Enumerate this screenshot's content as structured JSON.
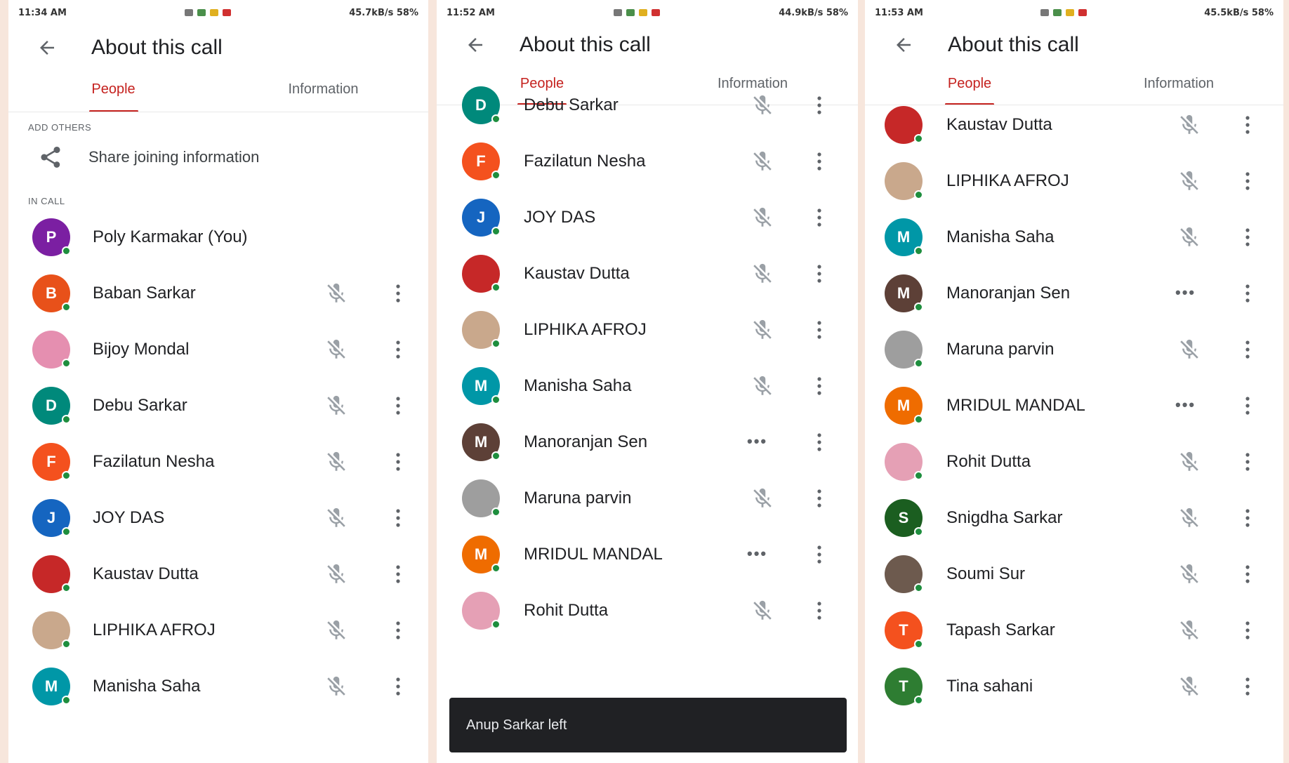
{
  "panels": [
    {
      "status_time": "11:34 AM",
      "status_right": "45.7kB/s 58%",
      "title": "About this call",
      "tabs": [
        "People",
        "Information"
      ],
      "add_others_label": "ADD OTHERS",
      "share_label": "Share joining information",
      "in_call_label": "IN CALL",
      "participants": [
        {
          "name": "Poly Karmakar (You)",
          "initial": "P",
          "color": "#7b1fa2",
          "status": "none"
        },
        {
          "name": "Baban Sarkar",
          "initial": "B",
          "color": "#e8511a",
          "status": "muted"
        },
        {
          "name": "Bijoy Mondal",
          "initial": "",
          "color": "#e58fb0",
          "status": "muted"
        },
        {
          "name": "Debu Sarkar",
          "initial": "D",
          "color": "#00897b",
          "status": "muted"
        },
        {
          "name": "Fazilatun Nesha",
          "initial": "F",
          "color": "#f4511e",
          "status": "muted"
        },
        {
          "name": "JOY DAS",
          "initial": "J",
          "color": "#1565c0",
          "status": "muted"
        },
        {
          "name": "Kaustav Dutta",
          "initial": "",
          "color": "#c62828",
          "status": "muted"
        },
        {
          "name": "LIPHIKA AFROJ",
          "initial": "",
          "color": "#c9a88c",
          "status": "muted"
        },
        {
          "name": "Manisha Saha",
          "initial": "M",
          "color": "#0097a7",
          "status": "muted"
        }
      ]
    },
    {
      "status_time": "11:52 AM",
      "status_right": "44.9kB/s 58%",
      "title": "About this call",
      "tabs": [
        "People",
        "Information"
      ],
      "participants": [
        {
          "name": "Debu Sarkar",
          "initial": "D",
          "color": "#00897b",
          "status": "muted"
        },
        {
          "name": "Fazilatun Nesha",
          "initial": "F",
          "color": "#f4511e",
          "status": "muted"
        },
        {
          "name": "JOY DAS",
          "initial": "J",
          "color": "#1565c0",
          "status": "muted"
        },
        {
          "name": "Kaustav Dutta",
          "initial": "",
          "color": "#c62828",
          "status": "muted"
        },
        {
          "name": "LIPHIKA AFROJ",
          "initial": "",
          "color": "#c9a88c",
          "status": "muted"
        },
        {
          "name": "Manisha Saha",
          "initial": "M",
          "color": "#0097a7",
          "status": "muted"
        },
        {
          "name": "Manoranjan Sen",
          "initial": "M",
          "color": "#5d4037",
          "status": "speaking"
        },
        {
          "name": "Maruna parvin",
          "initial": "",
          "color": "#9e9e9e",
          "status": "muted"
        },
        {
          "name": "MRIDUL MANDAL",
          "initial": "M",
          "color": "#ef6c00",
          "status": "speaking"
        },
        {
          "name": "Rohit Dutta",
          "initial": "",
          "color": "#e5a0b5",
          "status": "muted"
        }
      ],
      "toast": "Anup Sarkar left"
    },
    {
      "status_time": "11:53 AM",
      "status_right": "45.5kB/s 58%",
      "title": "About this call",
      "tabs": [
        "People",
        "Information"
      ],
      "participants": [
        {
          "name": "Kaustav Dutta",
          "initial": "",
          "color": "#c62828",
          "status": "muted"
        },
        {
          "name": "LIPHIKA AFROJ",
          "initial": "",
          "color": "#c9a88c",
          "status": "muted"
        },
        {
          "name": "Manisha Saha",
          "initial": "M",
          "color": "#0097a7",
          "status": "muted"
        },
        {
          "name": "Manoranjan Sen",
          "initial": "M",
          "color": "#5d4037",
          "status": "speaking"
        },
        {
          "name": "Maruna parvin",
          "initial": "",
          "color": "#9e9e9e",
          "status": "muted"
        },
        {
          "name": "MRIDUL MANDAL",
          "initial": "M",
          "color": "#ef6c00",
          "status": "speaking"
        },
        {
          "name": "Rohit Dutta",
          "initial": "",
          "color": "#e5a0b5",
          "status": "muted"
        },
        {
          "name": "Snigdha Sarkar",
          "initial": "S",
          "color": "#1b5e20",
          "status": "muted"
        },
        {
          "name": "Soumi Sur",
          "initial": "",
          "color": "#6d5a4e",
          "status": "muted"
        },
        {
          "name": "Tapash Sarkar",
          "initial": "T",
          "color": "#f4511e",
          "status": "muted"
        },
        {
          "name": "Tina sahani",
          "initial": "T",
          "color": "#2e7d32",
          "status": "muted"
        }
      ]
    }
  ],
  "icons": {
    "back": "arrow-back-icon",
    "share": "share-icon",
    "muted": "mic-off-icon",
    "speaking": "more-horiz-icon",
    "more": "more-vert-icon"
  },
  "speaking_glyph": "•••"
}
